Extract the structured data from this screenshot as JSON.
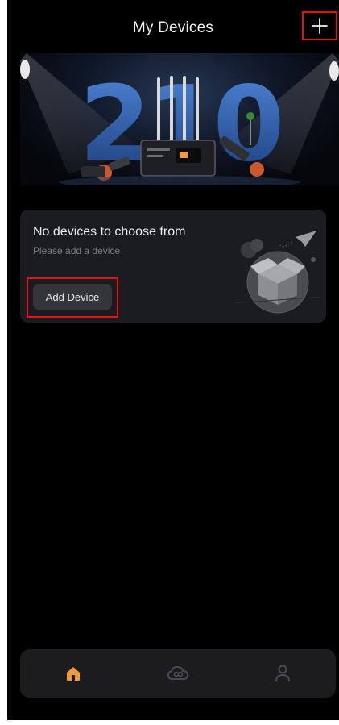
{
  "header": {
    "title": "My Devices",
    "add_icon": "plus-icon"
  },
  "banner": {
    "graphic_text": "210",
    "image": "product-promo-banner"
  },
  "empty_state": {
    "title": "No devices to choose from",
    "subtitle": "Please add a device",
    "button_label": "Add Device",
    "illustration": "empty-box-illustration"
  },
  "bottom_nav": {
    "items": [
      {
        "icon": "home-icon",
        "active": true
      },
      {
        "icon": "cloud-link-icon",
        "active": false
      },
      {
        "icon": "profile-icon",
        "active": false
      }
    ]
  },
  "colors": {
    "background": "#000000",
    "card": "#1b1c1f",
    "accent": "#f29a38",
    "highlight_outline": "#e0141b",
    "inactive_icon": "#4a4b50"
  }
}
